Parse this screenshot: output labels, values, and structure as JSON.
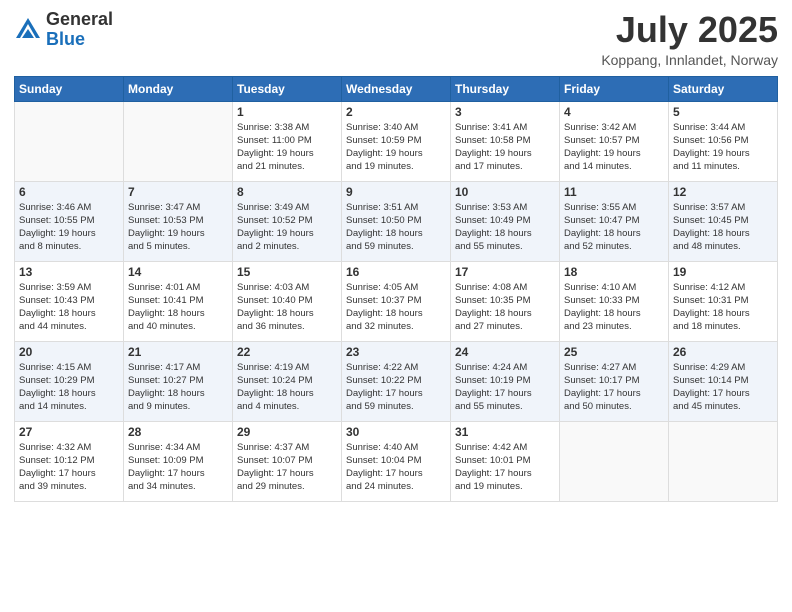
{
  "header": {
    "logo_general": "General",
    "logo_blue": "Blue",
    "month_year": "July 2025",
    "location": "Koppang, Innlandet, Norway"
  },
  "weekdays": [
    "Sunday",
    "Monday",
    "Tuesday",
    "Wednesday",
    "Thursday",
    "Friday",
    "Saturday"
  ],
  "weeks": [
    [
      {
        "day": "",
        "info": ""
      },
      {
        "day": "",
        "info": ""
      },
      {
        "day": "1",
        "info": "Sunrise: 3:38 AM\nSunset: 11:00 PM\nDaylight: 19 hours\nand 21 minutes."
      },
      {
        "day": "2",
        "info": "Sunrise: 3:40 AM\nSunset: 10:59 PM\nDaylight: 19 hours\nand 19 minutes."
      },
      {
        "day": "3",
        "info": "Sunrise: 3:41 AM\nSunset: 10:58 PM\nDaylight: 19 hours\nand 17 minutes."
      },
      {
        "day": "4",
        "info": "Sunrise: 3:42 AM\nSunset: 10:57 PM\nDaylight: 19 hours\nand 14 minutes."
      },
      {
        "day": "5",
        "info": "Sunrise: 3:44 AM\nSunset: 10:56 PM\nDaylight: 19 hours\nand 11 minutes."
      }
    ],
    [
      {
        "day": "6",
        "info": "Sunrise: 3:46 AM\nSunset: 10:55 PM\nDaylight: 19 hours\nand 8 minutes."
      },
      {
        "day": "7",
        "info": "Sunrise: 3:47 AM\nSunset: 10:53 PM\nDaylight: 19 hours\nand 5 minutes."
      },
      {
        "day": "8",
        "info": "Sunrise: 3:49 AM\nSunset: 10:52 PM\nDaylight: 19 hours\nand 2 minutes."
      },
      {
        "day": "9",
        "info": "Sunrise: 3:51 AM\nSunset: 10:50 PM\nDaylight: 18 hours\nand 59 minutes."
      },
      {
        "day": "10",
        "info": "Sunrise: 3:53 AM\nSunset: 10:49 PM\nDaylight: 18 hours\nand 55 minutes."
      },
      {
        "day": "11",
        "info": "Sunrise: 3:55 AM\nSunset: 10:47 PM\nDaylight: 18 hours\nand 52 minutes."
      },
      {
        "day": "12",
        "info": "Sunrise: 3:57 AM\nSunset: 10:45 PM\nDaylight: 18 hours\nand 48 minutes."
      }
    ],
    [
      {
        "day": "13",
        "info": "Sunrise: 3:59 AM\nSunset: 10:43 PM\nDaylight: 18 hours\nand 44 minutes."
      },
      {
        "day": "14",
        "info": "Sunrise: 4:01 AM\nSunset: 10:41 PM\nDaylight: 18 hours\nand 40 minutes."
      },
      {
        "day": "15",
        "info": "Sunrise: 4:03 AM\nSunset: 10:40 PM\nDaylight: 18 hours\nand 36 minutes."
      },
      {
        "day": "16",
        "info": "Sunrise: 4:05 AM\nSunset: 10:37 PM\nDaylight: 18 hours\nand 32 minutes."
      },
      {
        "day": "17",
        "info": "Sunrise: 4:08 AM\nSunset: 10:35 PM\nDaylight: 18 hours\nand 27 minutes."
      },
      {
        "day": "18",
        "info": "Sunrise: 4:10 AM\nSunset: 10:33 PM\nDaylight: 18 hours\nand 23 minutes."
      },
      {
        "day": "19",
        "info": "Sunrise: 4:12 AM\nSunset: 10:31 PM\nDaylight: 18 hours\nand 18 minutes."
      }
    ],
    [
      {
        "day": "20",
        "info": "Sunrise: 4:15 AM\nSunset: 10:29 PM\nDaylight: 18 hours\nand 14 minutes."
      },
      {
        "day": "21",
        "info": "Sunrise: 4:17 AM\nSunset: 10:27 PM\nDaylight: 18 hours\nand 9 minutes."
      },
      {
        "day": "22",
        "info": "Sunrise: 4:19 AM\nSunset: 10:24 PM\nDaylight: 18 hours\nand 4 minutes."
      },
      {
        "day": "23",
        "info": "Sunrise: 4:22 AM\nSunset: 10:22 PM\nDaylight: 17 hours\nand 59 minutes."
      },
      {
        "day": "24",
        "info": "Sunrise: 4:24 AM\nSunset: 10:19 PM\nDaylight: 17 hours\nand 55 minutes."
      },
      {
        "day": "25",
        "info": "Sunrise: 4:27 AM\nSunset: 10:17 PM\nDaylight: 17 hours\nand 50 minutes."
      },
      {
        "day": "26",
        "info": "Sunrise: 4:29 AM\nSunset: 10:14 PM\nDaylight: 17 hours\nand 45 minutes."
      }
    ],
    [
      {
        "day": "27",
        "info": "Sunrise: 4:32 AM\nSunset: 10:12 PM\nDaylight: 17 hours\nand 39 minutes."
      },
      {
        "day": "28",
        "info": "Sunrise: 4:34 AM\nSunset: 10:09 PM\nDaylight: 17 hours\nand 34 minutes."
      },
      {
        "day": "29",
        "info": "Sunrise: 4:37 AM\nSunset: 10:07 PM\nDaylight: 17 hours\nand 29 minutes."
      },
      {
        "day": "30",
        "info": "Sunrise: 4:40 AM\nSunset: 10:04 PM\nDaylight: 17 hours\nand 24 minutes."
      },
      {
        "day": "31",
        "info": "Sunrise: 4:42 AM\nSunset: 10:01 PM\nDaylight: 17 hours\nand 19 minutes."
      },
      {
        "day": "",
        "info": ""
      },
      {
        "day": "",
        "info": ""
      }
    ]
  ]
}
